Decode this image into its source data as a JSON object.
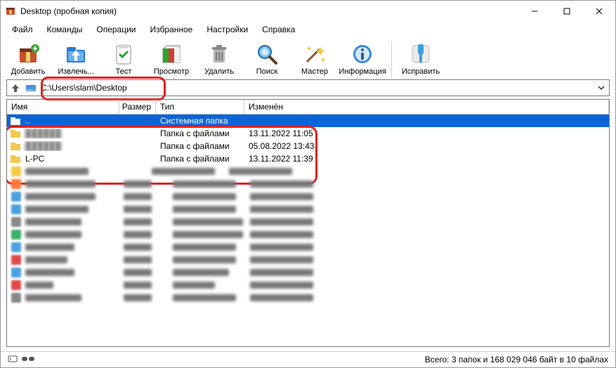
{
  "title": "Desktop (пробная копия)",
  "menu": [
    "Файл",
    "Команды",
    "Операции",
    "Избранное",
    "Настройки",
    "Справка"
  ],
  "toolbar": {
    "add": "Добавить",
    "extract": "Извлечь...",
    "test": "Тест",
    "view": "Просмотр",
    "delete": "Удалить",
    "find": "Поиск",
    "wizard": "Мастер",
    "info": "Информация",
    "repair": "Исправить"
  },
  "path": "C:\\Users\\slam\\Desktop",
  "columns": {
    "name": "Имя",
    "size": "Размер",
    "type": "Тип",
    "modified": "Изменён"
  },
  "rows": {
    "up": {
      "name": "..",
      "type": "Системная папка",
      "mod": ""
    },
    "r1": {
      "name": "",
      "type": "Папка с файлами",
      "mod": "13.11.2022 11:05"
    },
    "r2": {
      "name": "",
      "type": "Папка с файлами",
      "mod": "05.08.2022 13:43"
    },
    "r3": {
      "name": "L-PC",
      "type": "Папка с файлами",
      "mod": "13.11.2022 11:39"
    }
  },
  "status": "Всего: 3 папок и 168 029 046 байт в 10 файлах"
}
